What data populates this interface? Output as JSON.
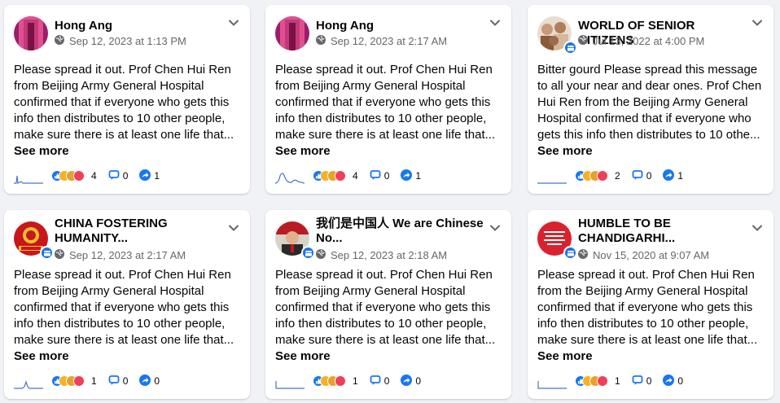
{
  "colors": {
    "background": "#f0f2f5",
    "card": "#ffffff",
    "text": "#050505",
    "muted": "#65676b",
    "accent": "#1877f2"
  },
  "posts": [
    {
      "author": "Hong Ang",
      "avatar_icon": "profile-photo",
      "page_badge": false,
      "audience_icon": "globe-icon",
      "timestamp": "Sep 12, 2023 at 1:13 PM",
      "text": "Please spread it out. Prof Chen Hui Ren from Beijing Army General Hospital confirmed that if everyone who gets this info then distributes to 10 other people, make sure there is at least one life that...",
      "see_more": "See more",
      "reactions": "4",
      "comments": "0",
      "shares": "1"
    },
    {
      "author": "Hong Ang",
      "avatar_icon": "profile-photo",
      "page_badge": false,
      "audience_icon": "globe-icon",
      "timestamp": "Sep 12, 2023 at 2:17 AM",
      "text": "Please spread it out. Prof Chen Hui Ren from Beijing Army General Hospital confirmed that if everyone who gets this info then distributes to 10 other people, make sure there is at least one life that...",
      "see_more": "See more",
      "reactions": "4",
      "comments": "0",
      "shares": "1"
    },
    {
      "author": "WORLD OF SENIOR CITIZENS",
      "avatar_icon": "group-photo",
      "page_badge": true,
      "audience_icon": "globe-icon",
      "timestamp": "Jul 13, 2022 at 4:00 PM",
      "text": "Bitter gourd Please spread this message to all your near and dear ones. Prof Chen Hui Ren from the Beijing Army General Hospital confirmed that if everyone who gets this info then distributes to 10 othe...",
      "see_more": "See more",
      "reactions": "2",
      "comments": "0",
      "shares": "1"
    },
    {
      "author": "CHINA FOSTERING HUMANITY...",
      "avatar_icon": "group-photo",
      "page_badge": true,
      "audience_icon": "globe-icon",
      "timestamp": "Sep 12, 2023 at 2:17 AM",
      "text": "Please spread it out. Prof Chen Hui Ren from Beijing Army General Hospital confirmed that if everyone who gets this info then distributes to 10 other people, make sure there is at least one life that...",
      "see_more": "See more",
      "reactions": "1",
      "comments": "0",
      "shares": "0"
    },
    {
      "author": "我们是中国人 We are Chinese No...",
      "avatar_icon": "group-photo",
      "page_badge": true,
      "audience_icon": "globe-icon",
      "timestamp": "Sep 12, 2023 at 2:18 AM",
      "text": "Please spread it out. Prof Chen Hui Ren from Beijing Army General Hospital confirmed that if everyone who gets this info then distributes to 10 other people, make sure there is at least one life that...",
      "see_more": "See more",
      "reactions": "1",
      "comments": "0",
      "shares": "0"
    },
    {
      "author": "HUMBLE TO BE CHANDIGARHI...",
      "avatar_icon": "group-photo",
      "page_badge": true,
      "audience_icon": "globe-icon",
      "timestamp": "Nov 15, 2020 at 9:07 AM",
      "text": "Please spread it out. Prof Chen Hui Ren from the Beijing Army General Hospital confirmed that if everyone who gets this info then distributes to 10 other people, make sure there is at least one life that...",
      "see_more": "See more",
      "reactions": "1",
      "comments": "0",
      "shares": "0"
    }
  ]
}
